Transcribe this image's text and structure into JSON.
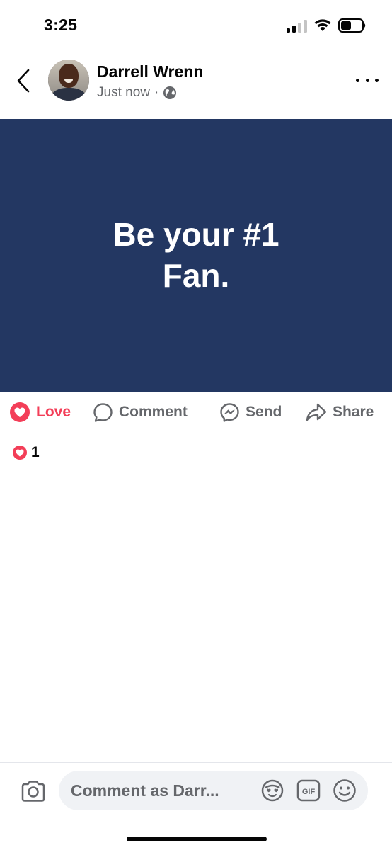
{
  "status_bar": {
    "time": "3:25"
  },
  "post": {
    "author": "Darrell Wrenn",
    "timestamp": "Just now",
    "separator": "·",
    "privacy_icon": "globe-icon",
    "image_text": "Be your #1 Fan.",
    "image_background": "#233762"
  },
  "actions": {
    "love_label": "Love",
    "comment_label": "Comment",
    "send_label": "Send",
    "share_label": "Share"
  },
  "reactions": {
    "count": "1",
    "icon": "love-reaction-icon"
  },
  "comment_bar": {
    "placeholder": "Comment as Darr..."
  },
  "colors": {
    "love_red": "#f33e58",
    "secondary_text": "#65676b",
    "input_bg": "#f0f2f5"
  }
}
